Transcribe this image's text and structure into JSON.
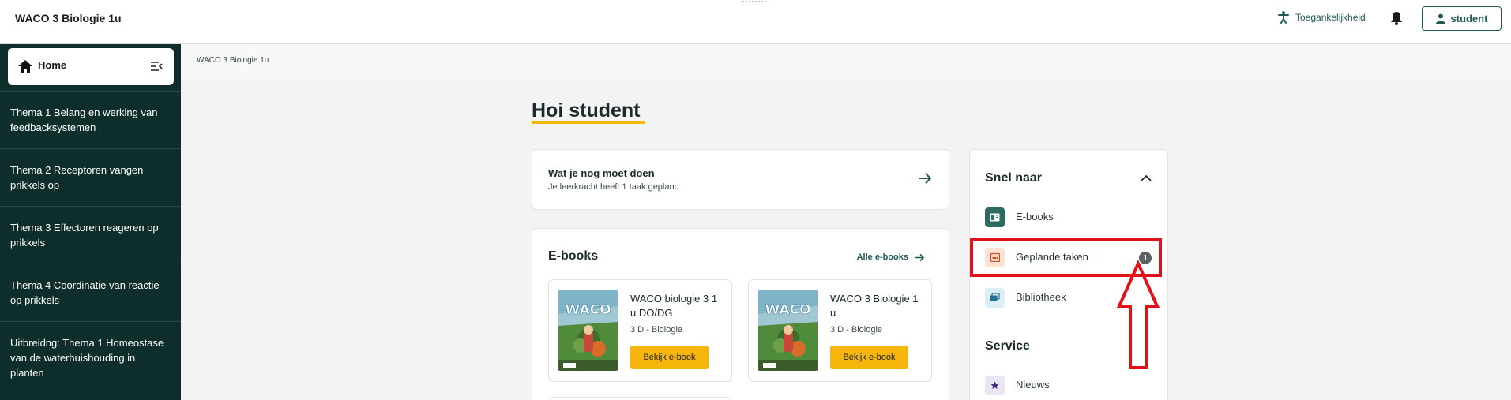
{
  "header": {
    "app_title": "WACO 3 Biologie 1u",
    "accessibility_label": "Toegankelijkheid",
    "user_label": "student"
  },
  "sidebar": {
    "home_label": "Home",
    "items": [
      {
        "label": "Thema 1 Belang en werking van feedbacksystemen"
      },
      {
        "label": "Thema 2 Receptoren vangen prikkels op"
      },
      {
        "label": "Thema 3 Effectoren reageren op prikkels"
      },
      {
        "label": "Thema 4 Coördinatie van reactie op prikkels"
      },
      {
        "label": "Uitbreidng: Thema 1 Homeostase van de waterhuishouding in planten"
      }
    ]
  },
  "breadcrumb": "WACO 3 Biologie 1u",
  "greeting": "Hoi student",
  "todo": {
    "title": "Wat je nog moet doen",
    "subtitle": "Je leerkracht heeft 1 taak gepland"
  },
  "ebooks": {
    "title": "E-books",
    "all_link": "Alle e-books",
    "books": [
      {
        "title": "WACO biologie 3 1 u DO/DG",
        "subtitle": "3 D - Biologie",
        "button": "Bekijk e-book",
        "cover_text": "WACO"
      },
      {
        "title": "WACO 3 Biologie 1 u",
        "subtitle": "3 D - Biologie",
        "button": "Bekijk e-book",
        "cover_text": "WACO"
      }
    ]
  },
  "quick_links": {
    "title": "Snel naar",
    "items": [
      {
        "label": "E-books",
        "icon": "book-icon"
      },
      {
        "label": "Geplande taken",
        "icon": "calendar-icon",
        "badge": "1"
      },
      {
        "label": "Bibliotheek",
        "icon": "library-icon"
      }
    ],
    "service_title": "Service",
    "service_items": [
      {
        "label": "Nieuws",
        "icon": "star-icon"
      }
    ]
  },
  "colors": {
    "primary": "#1f5a55",
    "sidebar_bg": "#0e2e2c",
    "accent": "#f5b50a",
    "annotation": "#e3101a"
  }
}
